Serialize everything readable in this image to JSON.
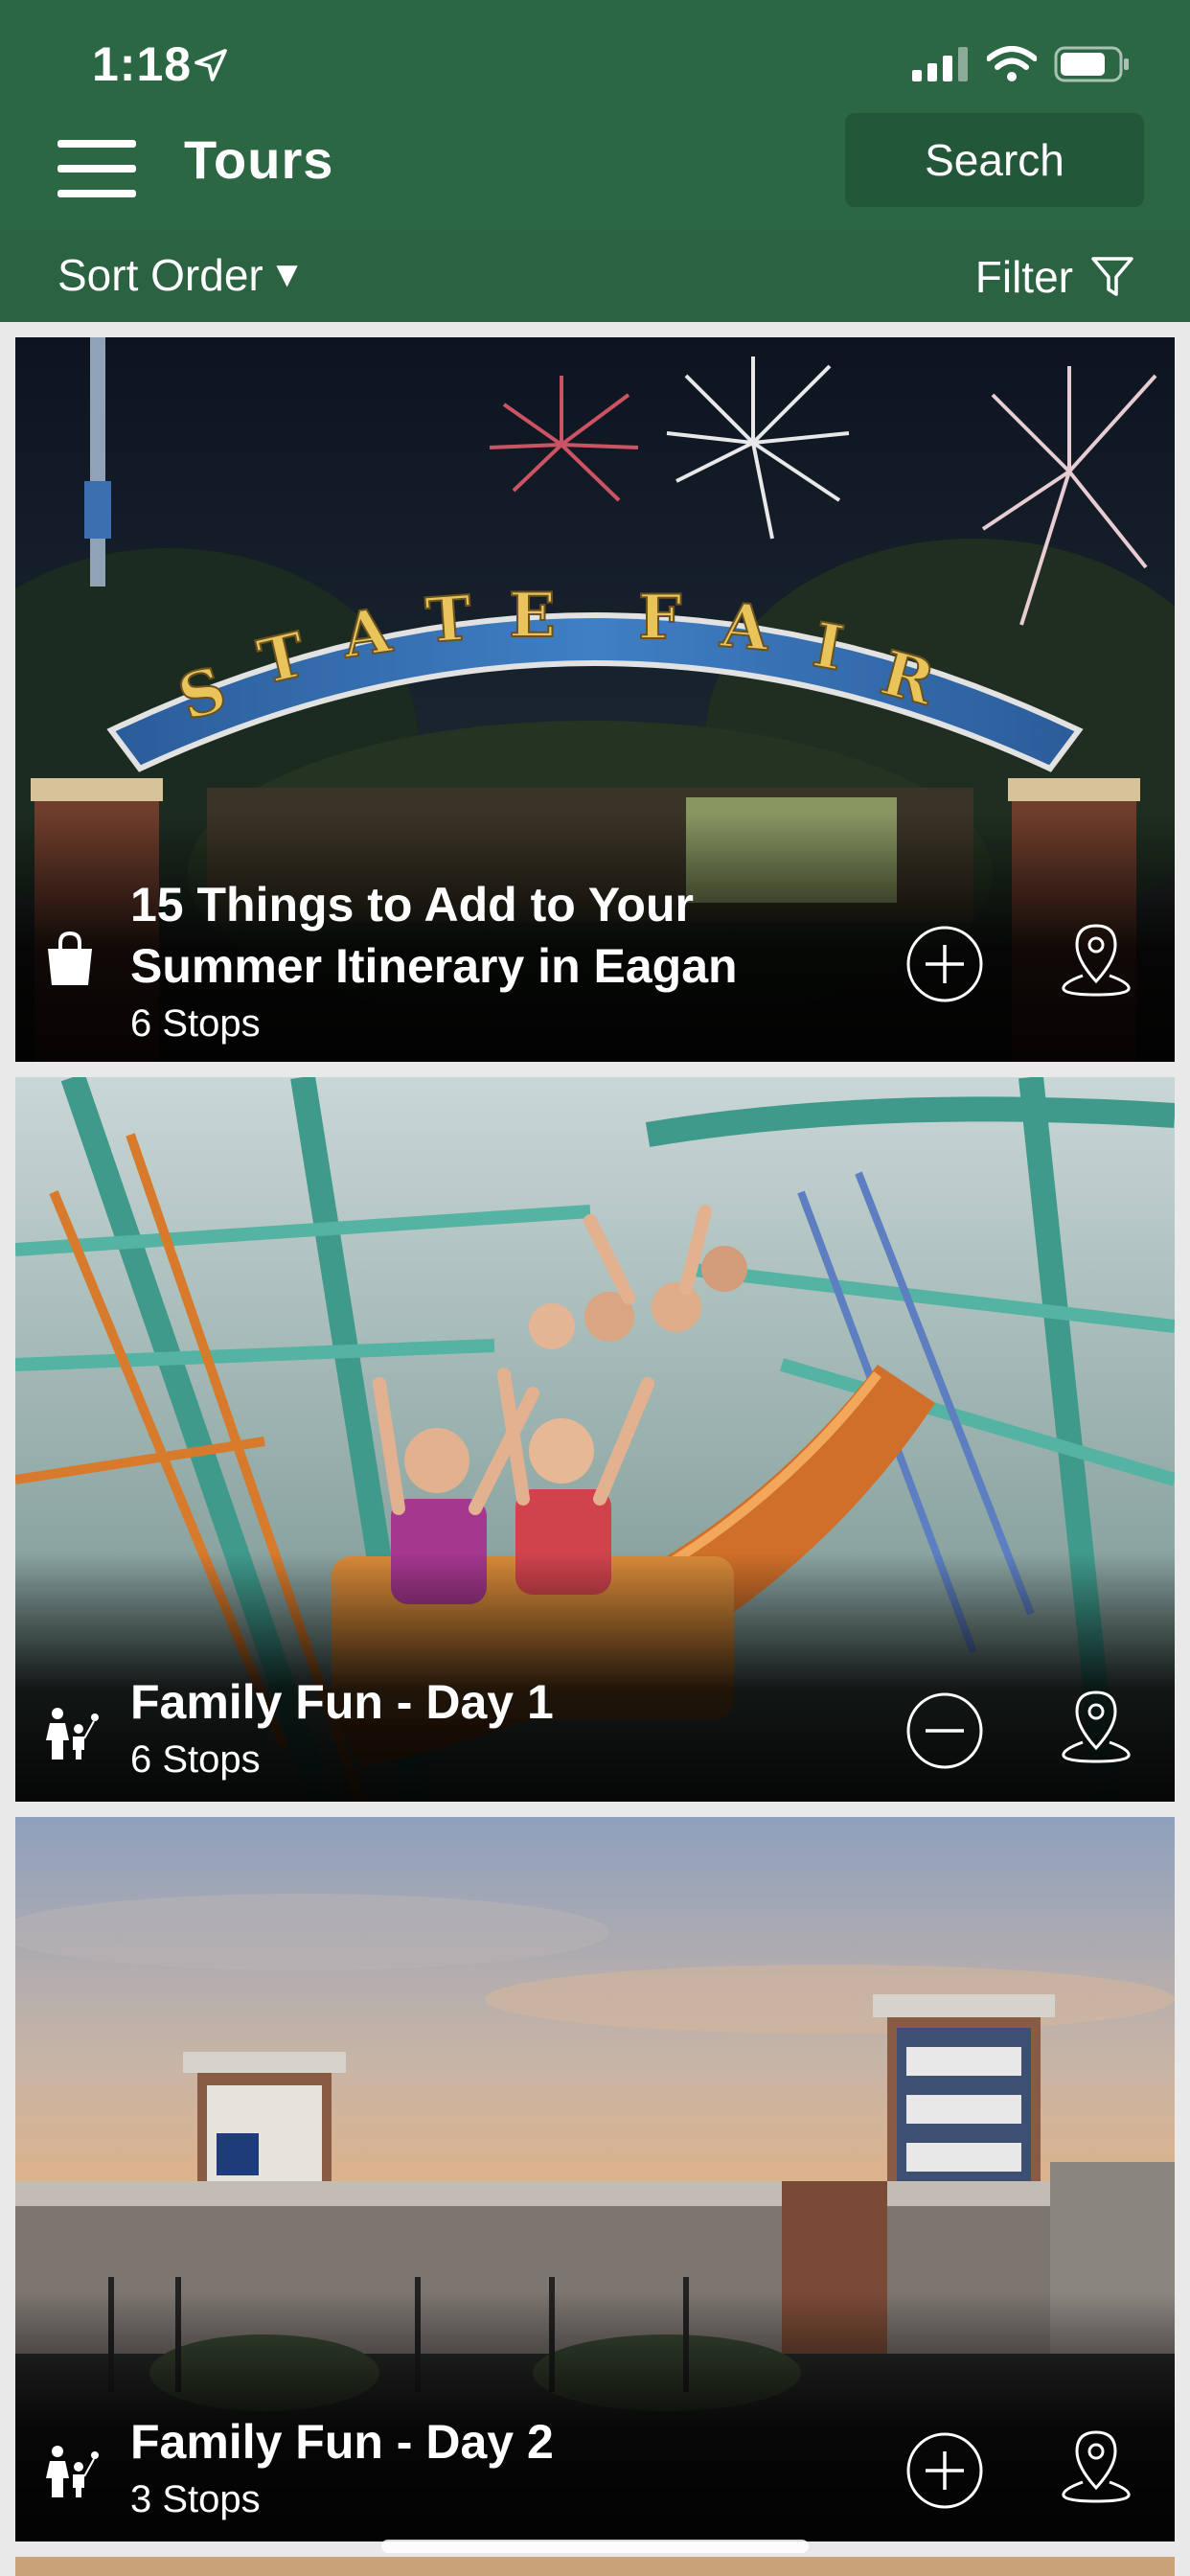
{
  "status_bar": {
    "time": "1:18",
    "icons": [
      "location-arrow-icon",
      "signal-icon",
      "wifi-icon",
      "battery-icon"
    ]
  },
  "header": {
    "title": "Tours",
    "search_label": "Search",
    "menu_icon": "hamburger-menu-icon"
  },
  "toolbar": {
    "sort_label": "Sort Order",
    "sort_caret": "▼",
    "filter_label": "Filter",
    "filter_icon": "funnel-icon"
  },
  "tours": [
    {
      "title": "15 Things to Add to Your Summer Itinerary in Eagan",
      "stops": "6 Stops",
      "category_icon": "shopping-bag-icon",
      "action_icon": "add-circle-icon",
      "map_icon": "map-pin-icon"
    },
    {
      "title": "Family Fun - Day 1",
      "stops": "6 Stops",
      "category_icon": "family-icon",
      "action_icon": "remove-circle-icon",
      "map_icon": "map-pin-icon"
    },
    {
      "title": "Family Fun - Day 2",
      "stops": "3 Stops",
      "category_icon": "family-icon",
      "action_icon": "add-circle-icon",
      "map_icon": "map-pin-icon"
    }
  ],
  "colors": {
    "header_green": "#2c6744",
    "search_button_green": "#22573a",
    "sort_bar_green": "#2a6242"
  }
}
